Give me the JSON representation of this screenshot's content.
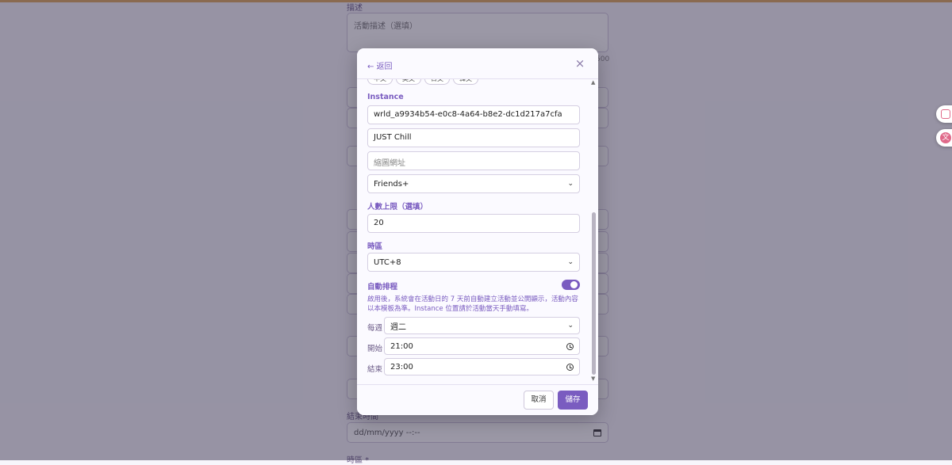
{
  "background_form": {
    "description_label": "描述",
    "description_placeholder": "活動描述（選填）",
    "description_counter": "500",
    "end_time_label": "結束時間",
    "end_time_value": "dd/mm/yyyy --:--",
    "timezone_label": "時區 *"
  },
  "modal": {
    "back_label": "← 返回",
    "close_label": "×",
    "languages": [
      "中文",
      "英文",
      "日文",
      "韓文"
    ],
    "instance_label": "Instance",
    "world_id": "wrld_a9934b54-e0c8-4a64-b8e2-dc1d217a7cfa",
    "world_name": "JUST Chill",
    "thumbnail_placeholder": "縮圖網址",
    "access_type": "Friends+",
    "capacity_label": "人數上限（選填）",
    "capacity_value": "20",
    "timezone_label": "時區",
    "timezone_value": "UTC+8",
    "auto_schedule_label": "自動排程",
    "auto_schedule_enabled": true,
    "auto_schedule_hint": "啟用後，系統會在活動日的 7 天前自動建立活動並公開顯示，活動內容以本模板為準。Instance 位置請於活動當天手動填寫。",
    "weekly_label": "每週",
    "weekly_value": "週二",
    "start_label": "開始",
    "start_value": "21:00",
    "end_label": "結束",
    "end_value": "23:00",
    "cancel_label": "取消",
    "save_label": "儲存"
  },
  "colors": {
    "accent": "#7a5cc0",
    "overlay": "#2d2846"
  }
}
